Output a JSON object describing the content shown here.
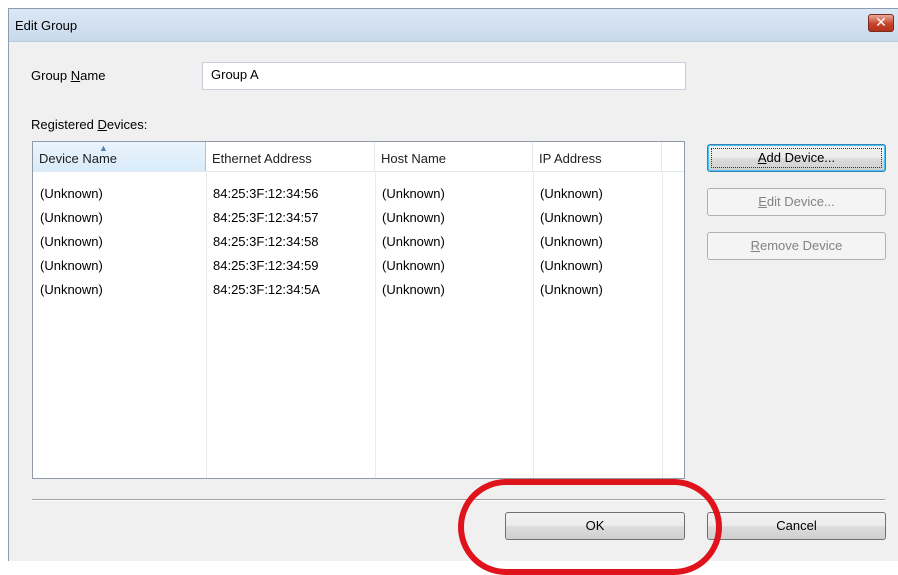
{
  "window": {
    "title": "Edit Group"
  },
  "form": {
    "group_name_label_pre": "Group ",
    "group_name_label_accel": "N",
    "group_name_label_post": "ame",
    "group_name_value": "Group A",
    "registered_label_pre": "Registered ",
    "registered_label_accel": "D",
    "registered_label_post": "evices:"
  },
  "table": {
    "columns": [
      "Device Name",
      "Ethernet Address",
      "Host Name",
      "IP Address"
    ],
    "rows": [
      [
        "(Unknown)",
        "84:25:3F:12:34:56",
        "(Unknown)",
        "(Unknown)"
      ],
      [
        "(Unknown)",
        "84:25:3F:12:34:57",
        "(Unknown)",
        "(Unknown)"
      ],
      [
        "(Unknown)",
        "84:25:3F:12:34:58",
        "(Unknown)",
        "(Unknown)"
      ],
      [
        "(Unknown)",
        "84:25:3F:12:34:59",
        "(Unknown)",
        "(Unknown)"
      ],
      [
        "(Unknown)",
        "84:25:3F:12:34:5A",
        "(Unknown)",
        "(Unknown)"
      ]
    ],
    "sort_indicator": "▲"
  },
  "buttons": {
    "add_accel": "A",
    "add_rest": "dd Device...",
    "edit_accel": "E",
    "edit_rest": "dit Device...",
    "remove_accel": "R",
    "remove_rest": "emove Device",
    "ok": "OK",
    "cancel": "Cancel"
  },
  "icons": {
    "close": "close-x-icon",
    "sort": "sort-ascending-icon"
  },
  "colors": {
    "annotation_ring": "#e0121b",
    "title_bar": "#c9daee",
    "close_button": "#c7432b"
  }
}
